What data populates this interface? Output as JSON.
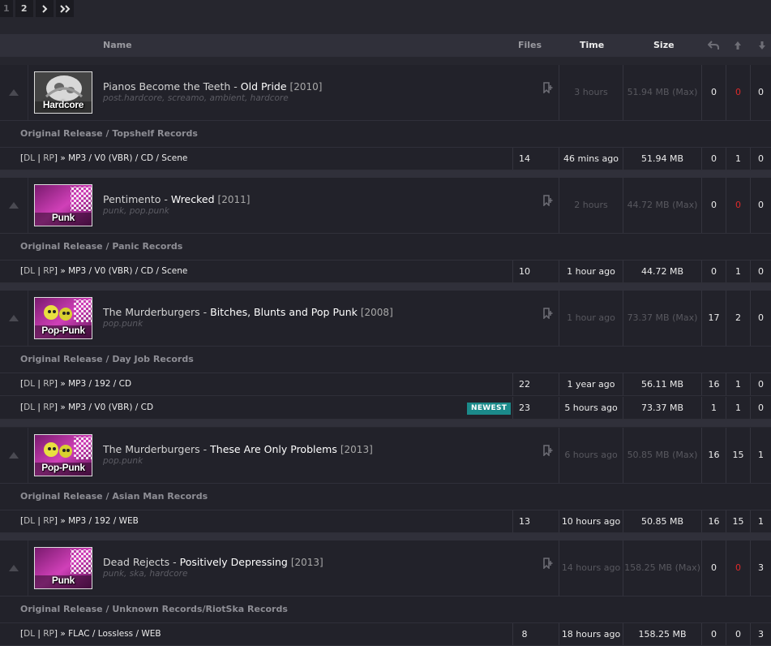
{
  "pagination": {
    "pages": [
      "1",
      "2"
    ],
    "next_icon": "chevron-right-icon",
    "last_icon": "double-chevron-right-icon"
  },
  "header": {
    "name": "Name",
    "files": "Files",
    "time": "Time",
    "size": "Size",
    "icons": [
      "snatched-icon",
      "seeders-icon",
      "leechers-icon"
    ]
  },
  "groups": [
    {
      "artist": "Pianos Become the Teeth",
      "album": "Old Pride",
      "year": "[2010]",
      "tags": "post.hardcore, screamo, ambient, hardcore",
      "genre_badge": "Hardcore",
      "time": "3 hours",
      "size": "51.94 MB (Max)",
      "snatched": "0",
      "seeders": "0",
      "leechers": "0",
      "editions": [
        {
          "label": "Original Release / Topshelf Records",
          "torrents": [
            {
              "dl": "DL",
              "rp": "RP",
              "format": "MP3 / V0 (VBR) / CD / Scene",
              "files": "14",
              "time": "46 mins ago",
              "size": "51.94 MB",
              "snatched": "0",
              "seeders": "1",
              "leechers": "0",
              "badge": ""
            }
          ]
        }
      ]
    },
    {
      "artist": "Pentimento",
      "album": "Wrecked",
      "year": "[2011]",
      "tags": "punk, pop.punk",
      "genre_badge": "Punk",
      "time": "2 hours",
      "size": "44.72 MB (Max)",
      "snatched": "0",
      "seeders": "0",
      "leechers": "0",
      "editions": [
        {
          "label": "Original Release / Panic Records",
          "torrents": [
            {
              "dl": "DL",
              "rp": "RP",
              "format": "MP3 / V0 (VBR) / CD / Scene",
              "files": "10",
              "time": "1 hour ago",
              "size": "44.72 MB",
              "snatched": "0",
              "seeders": "1",
              "leechers": "0",
              "badge": ""
            }
          ]
        }
      ]
    },
    {
      "artist": "The Murderburgers",
      "album": "Bitches, Blunts and Pop Punk",
      "year": "[2008]",
      "tags": "pop.punk",
      "genre_badge": "Pop-Punk",
      "time": "1 hour ago",
      "size": "73.37 MB (Max)",
      "snatched": "17",
      "seeders": "2",
      "leechers": "0",
      "editions": [
        {
          "label": "Original Release / Day Job Records",
          "torrents": [
            {
              "dl": "DL",
              "rp": "RP",
              "format": "MP3 / 192 / CD",
              "files": "22",
              "time": "1 year ago",
              "size": "56.11 MB",
              "snatched": "16",
              "seeders": "1",
              "leechers": "0",
              "badge": ""
            },
            {
              "dl": "DL",
              "rp": "RP",
              "format": "MP3 / V0 (VBR) / CD",
              "files": "23",
              "time": "5 hours ago",
              "size": "73.37 MB",
              "snatched": "1",
              "seeders": "1",
              "leechers": "0",
              "badge": "NEWEST"
            }
          ]
        }
      ]
    },
    {
      "artist": "The Murderburgers",
      "album": "These Are Only Problems",
      "year": "[2013]",
      "tags": "pop.punk",
      "genre_badge": "Pop-Punk",
      "time": "6 hours ago",
      "size": "50.85 MB (Max)",
      "snatched": "16",
      "seeders": "15",
      "leechers": "1",
      "editions": [
        {
          "label": "Original Release / Asian Man Records",
          "torrents": [
            {
              "dl": "DL",
              "rp": "RP",
              "format": "MP3 / 192 / WEB",
              "files": "13",
              "time": "10 hours ago",
              "size": "50.85 MB",
              "snatched": "16",
              "seeders": "15",
              "leechers": "1",
              "badge": ""
            }
          ]
        }
      ]
    },
    {
      "artist": "Dead Rejects",
      "album": "Positively Depressing",
      "year": "[2013]",
      "tags": "punk, ska, hardcore",
      "genre_badge": "Punk",
      "time": "14 hours ago",
      "size": "158.25 MB (Max)",
      "snatched": "0",
      "seeders": "0",
      "leechers": "3",
      "editions": [
        {
          "label": "Original Release / Unknown Records/RiotSka Records",
          "torrents": [
            {
              "dl": "DL",
              "rp": "RP",
              "format": "FLAC / Lossless / WEB",
              "files": "8",
              "time": "18 hours ago",
              "size": "158.25 MB",
              "snatched": "0",
              "seeders": "0",
              "leechers": "3",
              "badge": ""
            }
          ]
        }
      ]
    }
  ],
  "colors": {
    "accent_red": "#dd2a2a",
    "badge_teal": "#1b8a8a",
    "background": "#26262e"
  }
}
